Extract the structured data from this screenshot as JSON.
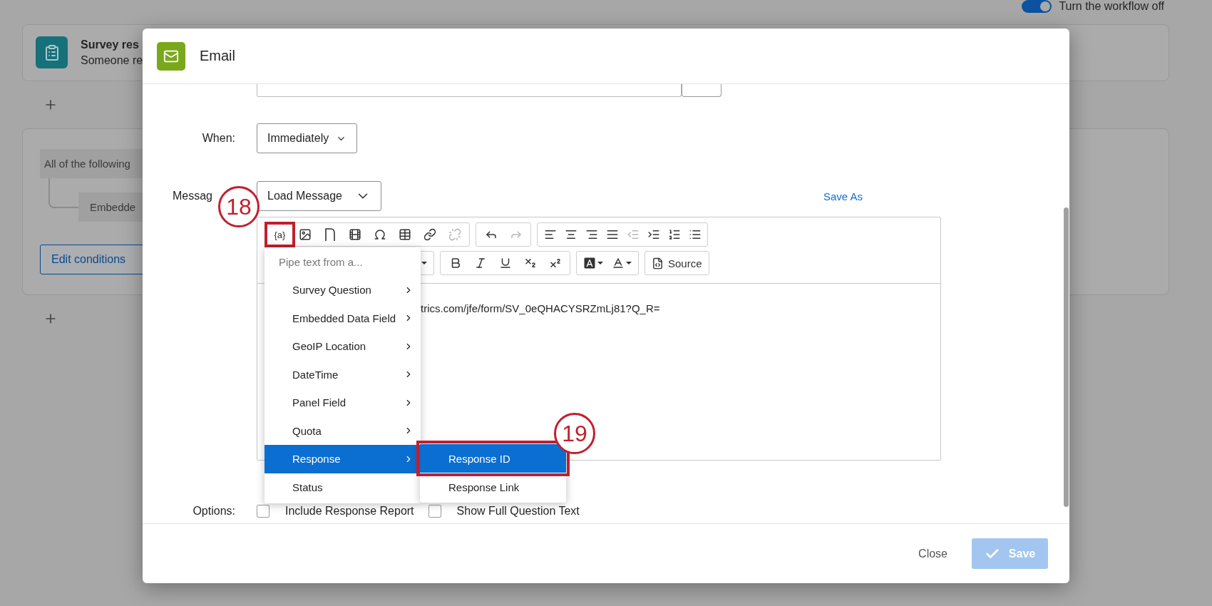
{
  "background": {
    "toggle": {
      "on": true
    },
    "toggle_label": "Turn the workflow off",
    "trigger_card": {
      "title": "Survey res",
      "subtitle": "Someone re"
    },
    "condition_card": {
      "group_label": "All of the following",
      "condition": "Embedde",
      "button": "Edit conditions"
    }
  },
  "dialog": {
    "title": "Email",
    "when": {
      "label": "When:",
      "value": "Immediately"
    },
    "message": {
      "label": "Messag",
      "load_button": "Load Message",
      "save_as": "Save As"
    },
    "editor": {
      "toolbar_rows": [
        [
          {
            "tools": [
              {
                "kind": "pipe",
                "label": "{a}",
                "disabled": false,
                "callout": true
              },
              {
                "kind": "image",
                "disabled": false
              },
              {
                "kind": "template",
                "disabled": false
              },
              {
                "kind": "media",
                "disabled": false
              },
              {
                "kind": "special-char",
                "disabled": false
              },
              {
                "kind": "table",
                "disabled": false
              },
              {
                "kind": "link",
                "disabled": false
              },
              {
                "kind": "unlink",
                "disabled": true
              }
            ]
          },
          {
            "tools": [
              {
                "kind": "undo",
                "disabled": false
              },
              {
                "kind": "redo",
                "disabled": true
              }
            ]
          },
          {
            "tools": [
              {
                "kind": "align-left",
                "disabled": false
              },
              {
                "kind": "align-center",
                "disabled": false
              },
              {
                "kind": "align-right",
                "disabled": false
              },
              {
                "kind": "align-justify",
                "disabled": false
              },
              {
                "kind": "outdent",
                "disabled": true
              },
              {
                "kind": "indent",
                "disabled": false
              },
              {
                "kind": "ordered-list",
                "disabled": false
              },
              {
                "kind": "bullet-list",
                "disabled": false
              }
            ]
          }
        ],
        [
          {
            "tools": [
              {
                "kind": "font-size",
                "disabled": false
              }
            ]
          },
          {
            "tools": [
              {
                "kind": "bold",
                "disabled": false
              },
              {
                "kind": "italic",
                "disabled": false
              },
              {
                "kind": "underline",
                "disabled": false
              },
              {
                "kind": "subscript",
                "disabled": false
              },
              {
                "kind": "superscript",
                "disabled": false
              }
            ]
          },
          {
            "tools": [
              {
                "kind": "background-color",
                "disabled": false
              },
              {
                "kind": "text-color",
                "disabled": false
              }
            ]
          },
          {
            "tools": [
              {
                "kind": "source",
                "label": "Source",
                "disabled": false
              }
            ]
          }
        ]
      ],
      "body": "trics.com/jfe/form/SV_0eQHACYSRZmLj81?Q_R="
    },
    "pipe_menu": {
      "header": "Pipe text from a...",
      "items": [
        {
          "label": "Survey Question",
          "selected": false
        },
        {
          "label": "Embedded Data Field",
          "selected": false
        },
        {
          "label": "GeoIP Location",
          "selected": false
        },
        {
          "label": "DateTime",
          "selected": false
        },
        {
          "label": "Panel Field",
          "selected": false
        },
        {
          "label": "Quota",
          "selected": false
        },
        {
          "label": "Response",
          "selected": true
        }
      ],
      "last_item": {
        "label": "Status",
        "selected": false
      },
      "submenu": [
        {
          "label": "Response ID",
          "selected": true,
          "callout": true
        },
        {
          "label": "Response Link",
          "selected": false,
          "callout": false
        }
      ]
    },
    "options": {
      "label": "Options:",
      "items": [
        {
          "label": "Include Response Report",
          "checked": false
        },
        {
          "label": "Show Full Question Text",
          "checked": false
        }
      ]
    },
    "footer": {
      "close": "Close",
      "save": "Save",
      "save_disabled": true
    }
  },
  "annotations": [
    {
      "number": "18"
    },
    {
      "number": "19"
    }
  ]
}
